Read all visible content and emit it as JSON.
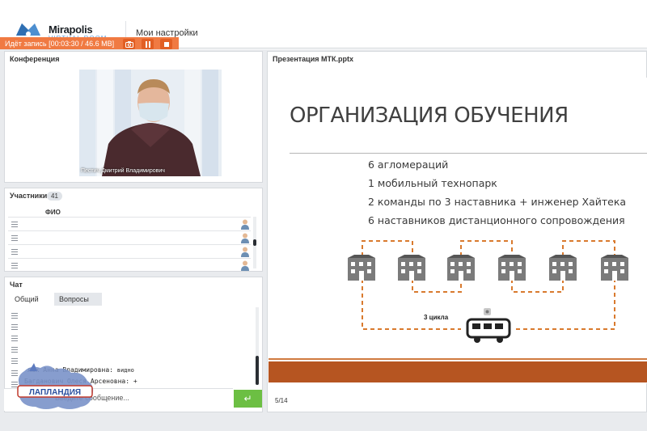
{
  "header": {
    "logo_text": "Mirapolis",
    "logo_sub": "VIRTUAL ROOM",
    "menu_item": "Мои настройки"
  },
  "recording": {
    "status_text": "Идёт запись [00:03:30 / 46.6 MB]",
    "buttons": [
      "camera-icon",
      "pause-icon",
      "stop-icon"
    ]
  },
  "conference": {
    "title": "Конференция",
    "speaker_name": "Пестич Дмитрий Владимирович"
  },
  "participants": {
    "title": "Участники",
    "count": "41",
    "column_header": "ФИО",
    "rows": 4
  },
  "chat": {
    "title": "Чат",
    "tabs": [
      "Общий",
      "Вопросы"
    ],
    "messages": [
      {
        "text": "люк Анна Владимировна:",
        "extra": "видно"
      },
      {
        "text": "Багданович Олеся Арсеновна:",
        "extra": "+"
      }
    ],
    "input_placeholder": "Введите сообщение...",
    "send_icon": "enter-icon"
  },
  "presentation": {
    "title": "Презентация МТК.pptx",
    "slide_title": "ОРГАНИЗАЦИЯ ОБУЧЕНИЯ",
    "bullets": [
      "6 агломераций",
      "1 мобильный технопарк",
      "2 команды по 3 наставника + инженер Хайтека",
      "6 наставников дистанционного сопровождения"
    ],
    "cycle_label": "3 цикла",
    "page": "5/14"
  },
  "watermark": {
    "text": "ЛАПЛАНДИЯ"
  },
  "colors": {
    "record_bar": "#f07a42",
    "accent_orange": "#d97a2e",
    "send_green": "#6cbf43",
    "footer_band": "#b65521"
  }
}
